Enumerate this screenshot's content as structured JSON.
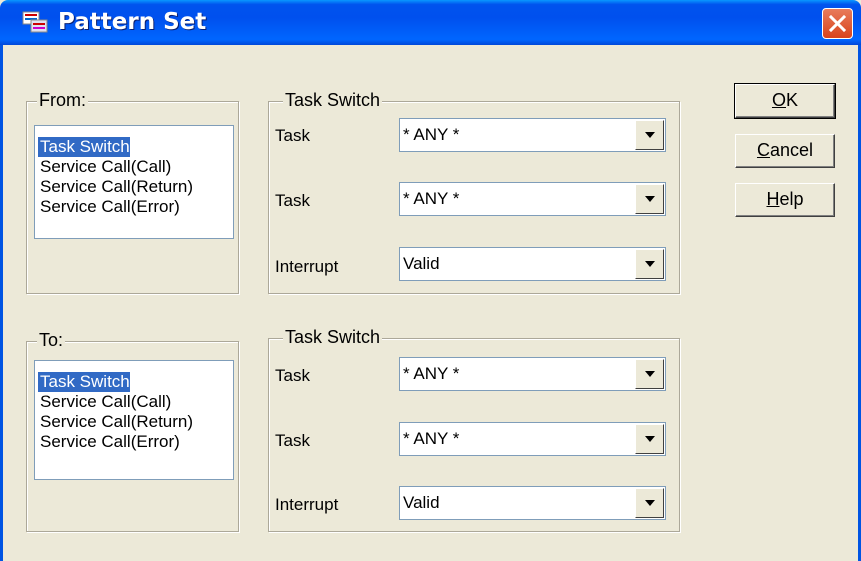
{
  "window": {
    "title": "Pattern Set"
  },
  "from_group": {
    "label": "From:",
    "items": [
      "Task Switch",
      "Service Call(Call)",
      "Service Call(Return)",
      "Service Call(Error)"
    ],
    "selected_index": 0
  },
  "from_settings": {
    "label": "Task Switch",
    "rows": [
      {
        "label": "Task",
        "value": "* ANY *"
      },
      {
        "label": "Task",
        "value": "* ANY *"
      },
      {
        "label": "Interrupt",
        "value": "Valid"
      }
    ]
  },
  "to_group": {
    "label": "To:",
    "items": [
      "Task Switch",
      "Service Call(Call)",
      "Service Call(Return)",
      "Service Call(Error)"
    ],
    "selected_index": 0
  },
  "to_settings": {
    "label": "Task Switch",
    "rows": [
      {
        "label": "Task",
        "value": "* ANY *"
      },
      {
        "label": "Task",
        "value": "* ANY *"
      },
      {
        "label": "Interrupt",
        "value": "Valid"
      }
    ]
  },
  "buttons": {
    "ok": {
      "mnemonic": "O",
      "rest": "K"
    },
    "cancel": {
      "mnemonic": "C",
      "rest": "ancel"
    },
    "help": {
      "mnemonic": "H",
      "rest": "elp"
    }
  },
  "icons": {
    "app": "pattern-app-icon",
    "close": "close-icon",
    "dropdown": "dropdown-arrow-icon"
  },
  "colors": {
    "titlebar": "#0054e3",
    "selection": "#316ac5",
    "face": "#ece9d8",
    "close": "#d9431c"
  }
}
